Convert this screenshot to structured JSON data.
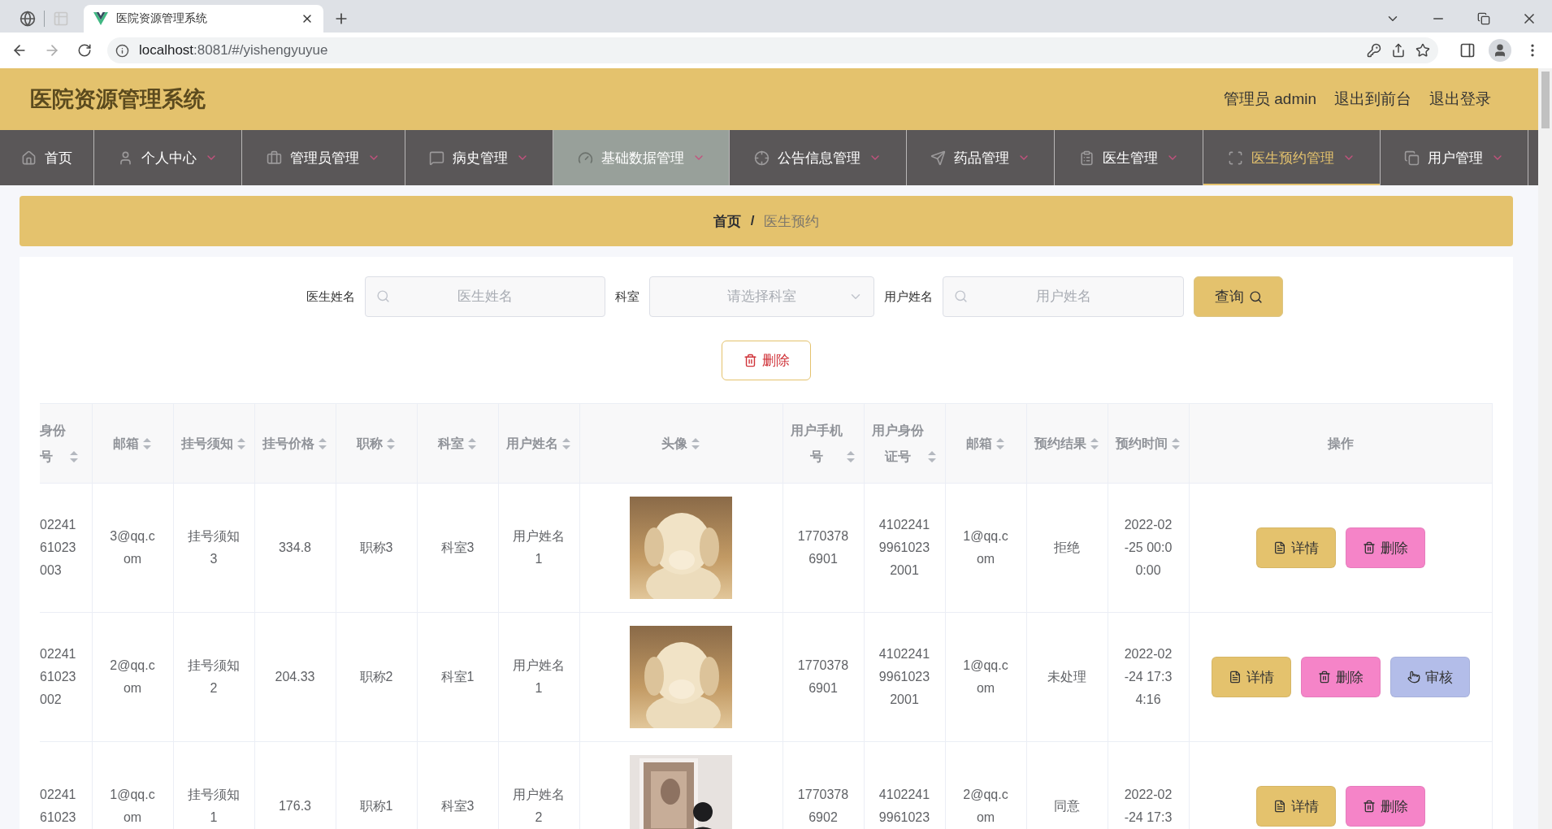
{
  "browser": {
    "tab_title": "医院资源管理系统",
    "url_host": "localhost",
    "url_path": ":8081/#/yishengyuyue"
  },
  "header": {
    "title": "医院资源管理系统",
    "user": "管理员 admin",
    "links": [
      "退出到前台",
      "退出登录"
    ]
  },
  "nav": [
    {
      "label": "首页",
      "has_menu": false,
      "selected": false,
      "hovered": false
    },
    {
      "label": "个人中心",
      "has_menu": true,
      "selected": false,
      "hovered": false
    },
    {
      "label": "管理员管理",
      "has_menu": true,
      "selected": false,
      "hovered": false
    },
    {
      "label": "病史管理",
      "has_menu": true,
      "selected": false,
      "hovered": false
    },
    {
      "label": "基础数据管理",
      "has_menu": true,
      "selected": false,
      "hovered": true
    },
    {
      "label": "公告信息管理",
      "has_menu": true,
      "selected": false,
      "hovered": false
    },
    {
      "label": "药品管理",
      "has_menu": true,
      "selected": false,
      "hovered": false
    },
    {
      "label": "医生管理",
      "has_menu": true,
      "selected": false,
      "hovered": false
    },
    {
      "label": "医生预约管理",
      "has_menu": true,
      "selected": true,
      "hovered": false
    },
    {
      "label": "用户管理",
      "has_menu": true,
      "selected": false,
      "hovered": false
    }
  ],
  "breadcrumb": {
    "separator": "/",
    "items": [
      {
        "label": "首页",
        "current": false
      },
      {
        "label": "医生预约",
        "current": true
      }
    ]
  },
  "search": {
    "fields": [
      {
        "label": "医生姓名",
        "kind": "text",
        "placeholder": "医生姓名"
      },
      {
        "label": "科室",
        "kind": "select",
        "placeholder": "请选择科室"
      },
      {
        "label": "用户姓名",
        "kind": "text",
        "placeholder": "用户姓名"
      }
    ],
    "button": "查询"
  },
  "delete_button": "删除",
  "table": {
    "columns": [
      {
        "label": "身份号",
        "sortable": true
      },
      {
        "label": "邮箱",
        "sortable": true
      },
      {
        "label": "挂号须知",
        "sortable": true
      },
      {
        "label": "挂号价格",
        "sortable": true
      },
      {
        "label": "职称",
        "sortable": true
      },
      {
        "label": "科室",
        "sortable": true
      },
      {
        "label": "用户姓名",
        "sortable": true
      },
      {
        "label": "头像",
        "sortable": true
      },
      {
        "label": "用户手机号",
        "sortable": true
      },
      {
        "label": "用户身份证号",
        "sortable": true
      },
      {
        "label": "邮箱",
        "sortable": true
      },
      {
        "label": "预约结果",
        "sortable": true
      },
      {
        "label": "预约时间",
        "sortable": true
      },
      {
        "label": "操作",
        "sortable": false
      }
    ],
    "rows": [
      {
        "cells": [
          "02241\n61023\n003",
          "3@qq.c\nom",
          "挂号须知\n3",
          "334.8",
          "职称3",
          "科室3",
          "用户姓名\n1",
          {
            "kind": "picture"
          },
          "1770378\n6901",
          "4102241\n9961023\n2001",
          "1@qq.c\nom",
          "拒绝",
          "2022-02\n-25 00:0\n0:00"
        ],
        "actions": [
          {
            "kind": "detail",
            "label": "详情"
          },
          {
            "kind": "delete",
            "label": "删除"
          }
        ]
      },
      {
        "cells": [
          "02241\n61023\n002",
          "2@qq.c\nom",
          "挂号须知\n2",
          "204.33",
          "职称2",
          "科室1",
          "用户姓名\n1",
          {
            "kind": "picture"
          },
          "1770378\n6901",
          "4102241\n9961023\n2001",
          "1@qq.c\nom",
          "未处理",
          "2022-02\n-24 17:3\n4:16"
        ],
        "actions": [
          {
            "kind": "detail",
            "label": "详情"
          },
          {
            "kind": "delete",
            "label": "删除"
          },
          {
            "kind": "review",
            "label": "审核"
          }
        ]
      },
      {
        "cells": [
          "02241\n61023",
          "1@qq.c\nom",
          "挂号须知\n1",
          "176.3",
          "职称1",
          "科室3",
          "用户姓名\n2",
          {
            "kind": "picture"
          },
          "1770378\n6902",
          "4102241\n9961023",
          "2@qq.c\nom",
          "同意",
          "2022-02\n-24 17:3"
        ],
        "actions": [
          {
            "kind": "detail",
            "label": "详情"
          },
          {
            "kind": "delete",
            "label": "删除"
          }
        ]
      }
    ]
  }
}
